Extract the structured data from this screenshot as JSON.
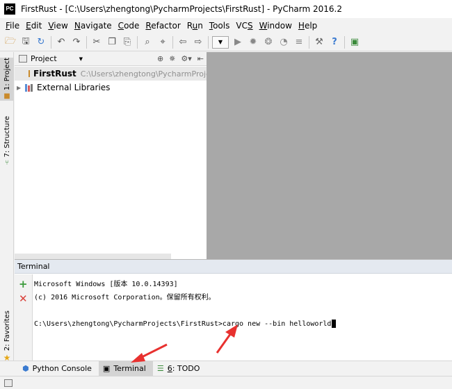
{
  "window": {
    "app_logo": "PC",
    "title": "FirstRust - [C:\\Users\\zhengtong\\PycharmProjects\\FirstRust] - PyCharm 2016.2"
  },
  "menu": [
    {
      "pre": "",
      "key": "F",
      "post": "ile"
    },
    {
      "pre": "",
      "key": "E",
      "post": "dit"
    },
    {
      "pre": "",
      "key": "V",
      "post": "iew"
    },
    {
      "pre": "",
      "key": "N",
      "post": "avigate"
    },
    {
      "pre": "",
      "key": "C",
      "post": "ode"
    },
    {
      "pre": "",
      "key": "R",
      "post": "efactor"
    },
    {
      "pre": "R",
      "key": "u",
      "post": "n"
    },
    {
      "pre": "",
      "key": "T",
      "post": "ools"
    },
    {
      "pre": "VC",
      "key": "S",
      "post": ""
    },
    {
      "pre": "",
      "key": "W",
      "post": "indow"
    },
    {
      "pre": "",
      "key": "H",
      "post": "elp"
    }
  ],
  "toolbar": {
    "icons": [
      "open-folder-icon",
      "save-icon",
      "sync-icon",
      "undo-icon",
      "redo-icon",
      "cut-icon",
      "copy-icon",
      "paste-icon",
      "find-icon",
      "replace-icon",
      "back-icon",
      "forward-icon",
      "run-config-dropdown",
      "run-icon",
      "debug-icon",
      "coverage-icon",
      "profile-icon",
      "concurrency-icon",
      "settings-icon",
      "help-icon",
      "sdk-icon"
    ]
  },
  "left_strip": {
    "project_tab": "1: Project",
    "structure_tab": "7: Structure",
    "favorites_tab": "2: Favorites"
  },
  "project_panel": {
    "header_label": "Project",
    "tree": [
      {
        "name": "FirstRust",
        "path": "C:\\Users\\zhengtong\\PycharmProjects\\FirstRust"
      },
      {
        "name": "External Libraries"
      }
    ]
  },
  "terminal": {
    "title": "Terminal",
    "lines": [
      "Microsoft Windows [版本 10.0.14393]",
      "(c) 2016 Microsoft Corporation。保留所有权利。",
      "",
      "C:\\Users\\zhengtong\\PycharmProjects\\FirstRust>cargo new --bin helloworld"
    ]
  },
  "bottom_tabs": {
    "python_console": "Python Console",
    "terminal": "Terminal",
    "todo_key": "6",
    "todo_rest": ": TODO"
  },
  "colors": {
    "annotation_arrow": "#e8312f",
    "selection": "#e8e8e8",
    "editor_background": "#a8a8a8"
  }
}
